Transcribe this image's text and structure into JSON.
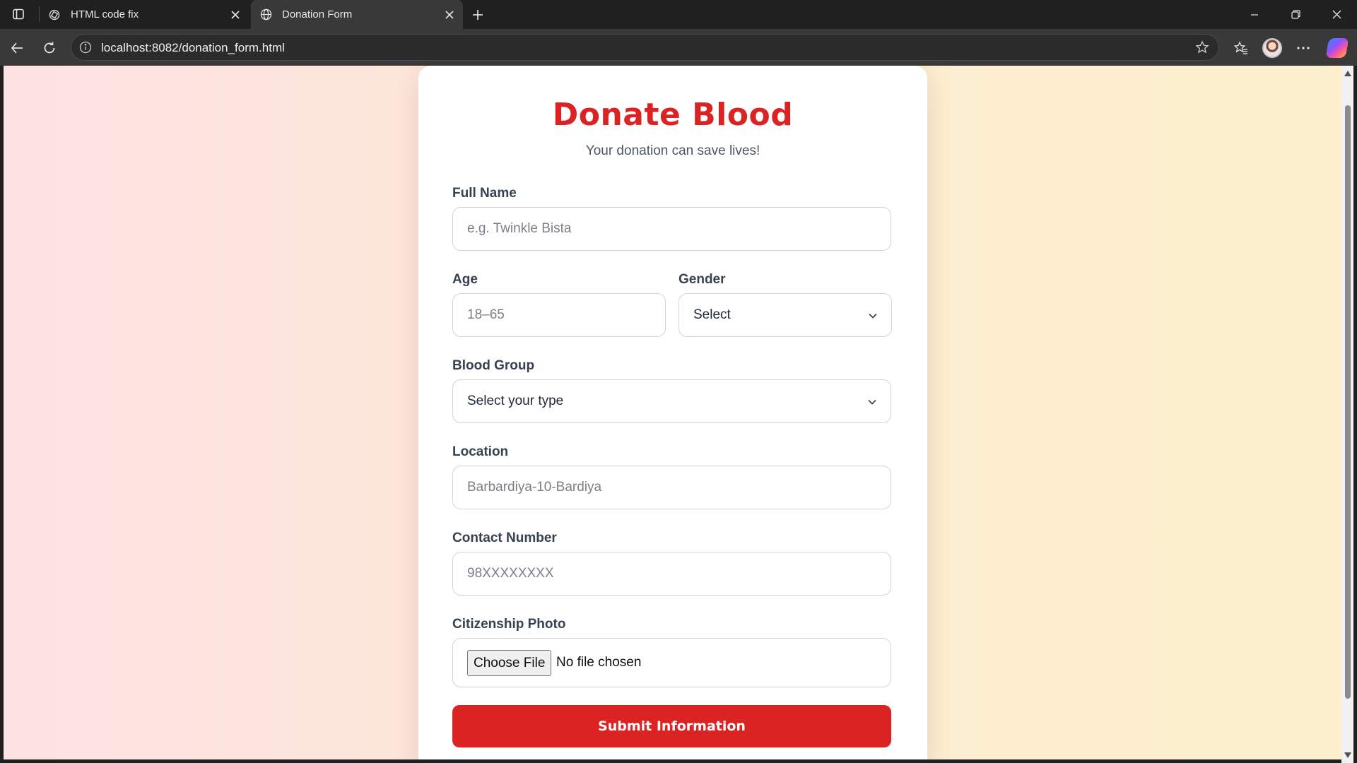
{
  "browser": {
    "tabs": [
      {
        "title": "HTML code fix",
        "active": false,
        "icon": "chatgpt-icon"
      },
      {
        "title": "Donation Form",
        "active": true,
        "icon": "globe-icon"
      }
    ],
    "url": "localhost:8082/donation_form.html"
  },
  "form": {
    "title": "Donate Blood",
    "subtitle": "Your donation can save lives!",
    "full_name": {
      "label": "Full Name",
      "placeholder": "e.g. Twinkle Bista"
    },
    "age": {
      "label": "Age",
      "placeholder": "18–65"
    },
    "gender": {
      "label": "Gender",
      "selected": "Select"
    },
    "blood_group": {
      "label": "Blood Group",
      "selected": "Select your type"
    },
    "location": {
      "label": "Location",
      "placeholder": "Barbardiya-10-Bardiya"
    },
    "contact": {
      "label": "Contact Number",
      "placeholder": "98XXXXXXXX"
    },
    "citizenship_photo": {
      "label": "Citizenship Photo",
      "button": "Choose File",
      "status": "No file chosen"
    },
    "submit_label": "Submit Information"
  },
  "colors": {
    "accent": "#dc2323",
    "label": "#374151",
    "subtitle": "#4b5563"
  }
}
